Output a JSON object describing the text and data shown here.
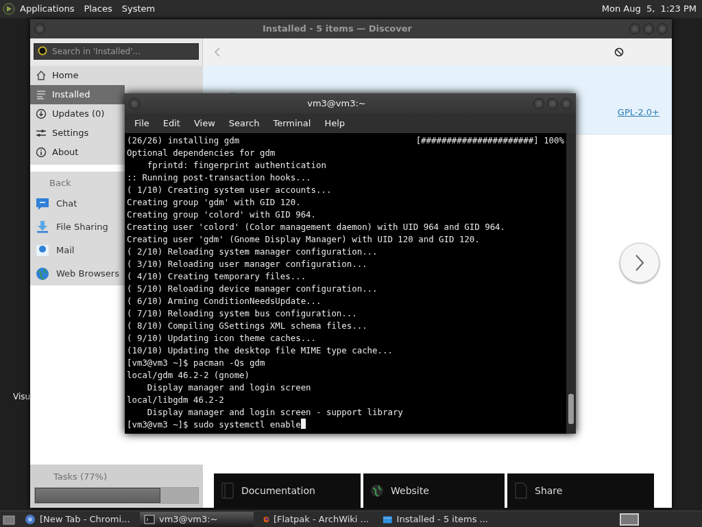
{
  "top_panel": {
    "menus": [
      "Applications",
      "Places",
      "System"
    ],
    "clock": "Mon Aug  5,  1:23 PM"
  },
  "desktop": {
    "icon_label": "Visu"
  },
  "discover": {
    "title": "Installed - 5 items — Discover",
    "search": {
      "placeholder": "Search in 'Installed'..."
    },
    "nav": [
      {
        "label": "Home",
        "selected": false
      },
      {
        "label": "Installed",
        "selected": true
      },
      {
        "label": "Updates (0)",
        "selected": false
      },
      {
        "label": "Settings",
        "selected": false
      },
      {
        "label": "About",
        "selected": false
      }
    ],
    "back": "Back",
    "categories": [
      {
        "label": "Chat"
      },
      {
        "label": "File Sharing"
      },
      {
        "label": "Mail"
      },
      {
        "label": "Web Browsers"
      }
    ],
    "license": "GPL-2.0+",
    "tasks": {
      "label": "Tasks (77%)",
      "level": 0.77
    },
    "actions": [
      "Documentation",
      "Website",
      "Share"
    ]
  },
  "terminal": {
    "title": "vm3@vm3:~",
    "menu": [
      "File",
      "Edit",
      "View",
      "Search",
      "Terminal",
      "Help"
    ],
    "progress": "[######################] 100%",
    "lines": [
      "(26/26) installing gdm",
      "Optional dependencies for gdm",
      "    fprintd: fingerprint authentication",
      ":: Running post-transaction hooks...",
      "( 1/10) Creating system user accounts...",
      "Creating group 'gdm' with GID 120.",
      "Creating group 'colord' with GID 964.",
      "Creating user 'colord' (Color management daemon) with UID 964 and GID 964.",
      "Creating user 'gdm' (Gnome Display Manager) with UID 120 and GID 120.",
      "( 2/10) Reloading system manager configuration...",
      "( 3/10) Reloading user manager configuration...",
      "( 4/10) Creating temporary files...",
      "( 5/10) Reloading device manager configuration...",
      "( 6/10) Arming ConditionNeedsUpdate...",
      "( 7/10) Reloading system bus configuration...",
      "( 8/10) Compiling GSettings XML schema files...",
      "( 9/10) Updating icon theme caches...",
      "(10/10) Updating the desktop file MIME type cache...",
      "[vm3@vm3 ~]$ pacman -Qs gdm",
      "local/gdm 46.2-2 (gnome)",
      "    Display manager and login screen",
      "local/libgdm 46.2-2",
      "    Display manager and login screen - support library",
      "[vm3@vm3 ~]$ sudo systemctl enable"
    ]
  },
  "taskbar": {
    "tasks": [
      {
        "label": "[New Tab - Chromi...",
        "selected": false
      },
      {
        "label": "vm3@vm3:~",
        "selected": true
      },
      {
        "label": "[Flatpak - ArchWiki ...",
        "selected": false
      },
      {
        "label": "Installed - 5 items ...",
        "selected": false
      }
    ]
  }
}
